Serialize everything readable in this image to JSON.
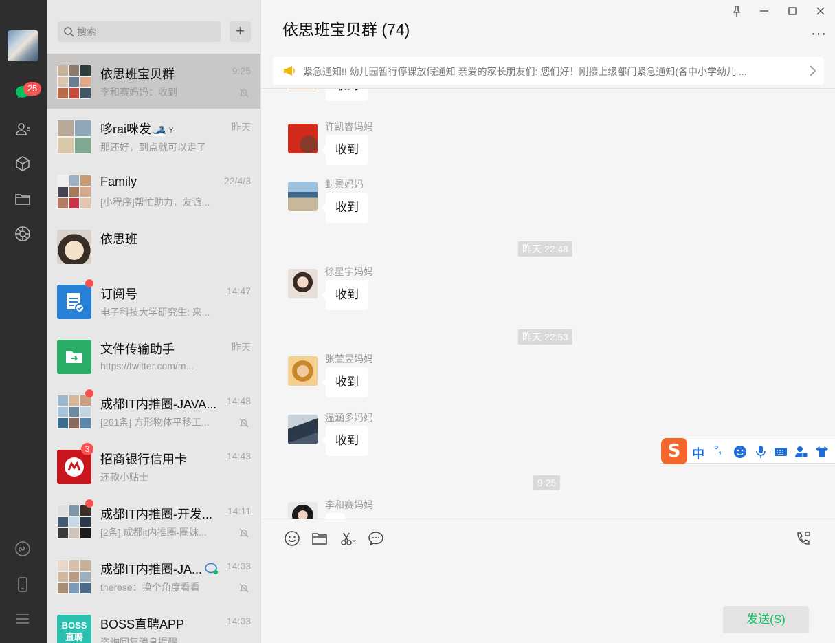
{
  "app": {
    "unread_badge": "25"
  },
  "rail": {
    "icons": [
      "avatar",
      "chat-icon",
      "contacts-icon",
      "favorites-icon",
      "folder-icon",
      "moments-icon",
      "miniprogram-icon",
      "phone-icon",
      "menu-icon"
    ]
  },
  "search": {
    "placeholder": "搜索",
    "add_label": "+"
  },
  "chats": [
    {
      "title": "依思班宝贝群",
      "time": "9:25",
      "preview": "李和赛妈妈：收到",
      "muted": true,
      "active": true
    },
    {
      "title": "哆rai咪发🎿♀",
      "time": "昨天",
      "preview": "那还好，到点就可以走了",
      "muted": false
    },
    {
      "title": "Family",
      "time": "22/4/3",
      "preview": "[小程序]帮忙助力，友谊...",
      "muted": false
    },
    {
      "title": "依思班",
      "time": "",
      "preview": "",
      "muted": false
    },
    {
      "title": "订阅号",
      "time": "14:47",
      "preview": "电子科技大学研究生: 来...",
      "muted": false,
      "dot": true
    },
    {
      "title": "文件传输助手",
      "time": "昨天",
      "preview": "https://twitter.com/m...",
      "muted": false
    },
    {
      "title": "成都IT内推圈-JAVA...",
      "time": "14:48",
      "preview": "[261条] 方形物体平移工...",
      "muted": true,
      "dot": true
    },
    {
      "title": "招商银行信用卡",
      "time": "14:43",
      "preview": "还款小贴士",
      "muted": false,
      "badge": "3"
    },
    {
      "title": "成都IT内推圈-开发...",
      "time": "14:11",
      "preview": "[2条] 成都it内推圈-圈妹...",
      "muted": true,
      "dot": true
    },
    {
      "title": "成都IT内推圈-JA...",
      "time": "14:03",
      "preview": "therese：换个角度看看",
      "muted": true
    },
    {
      "title": "BOSS直聘APP",
      "time": "14:03",
      "preview": "咨询回复消息提醒",
      "muted": false,
      "thumb_text": "BOSS 直聘"
    }
  ],
  "chat": {
    "title": "依思班宝贝群 (74)",
    "more_label": "···",
    "notice": "紧急通知!! 幼儿园暂行停课放假通知 亲爱的家长朋友们:      您们好！刚接上级部门紧急通知(各中小学幼儿 ...",
    "messages": [
      {
        "sender": "",
        "text": "收到"
      },
      {
        "sender": "许凯睿妈妈",
        "text": "收到"
      },
      {
        "sender": "封景妈妈",
        "text": "收到"
      },
      {
        "sender": "徐星宇妈妈",
        "text": "收到"
      },
      {
        "sender": "张萱昱妈妈",
        "text": "收到"
      },
      {
        "sender": "温涵多妈妈",
        "text": "收到"
      },
      {
        "sender": "李和赛妈妈",
        "text": ""
      }
    ],
    "timestamps": [
      "昨天 22:48",
      "昨天 22:53",
      "9:25"
    ]
  },
  "ime": {
    "logo": "S",
    "mode": "中",
    "punct": "°,"
  },
  "composer": {
    "send_label": "发送(S)"
  },
  "colors": {
    "accent_green": "#07c160",
    "badge_red": "#fa5151",
    "rail_bg": "#2e2e2e"
  }
}
